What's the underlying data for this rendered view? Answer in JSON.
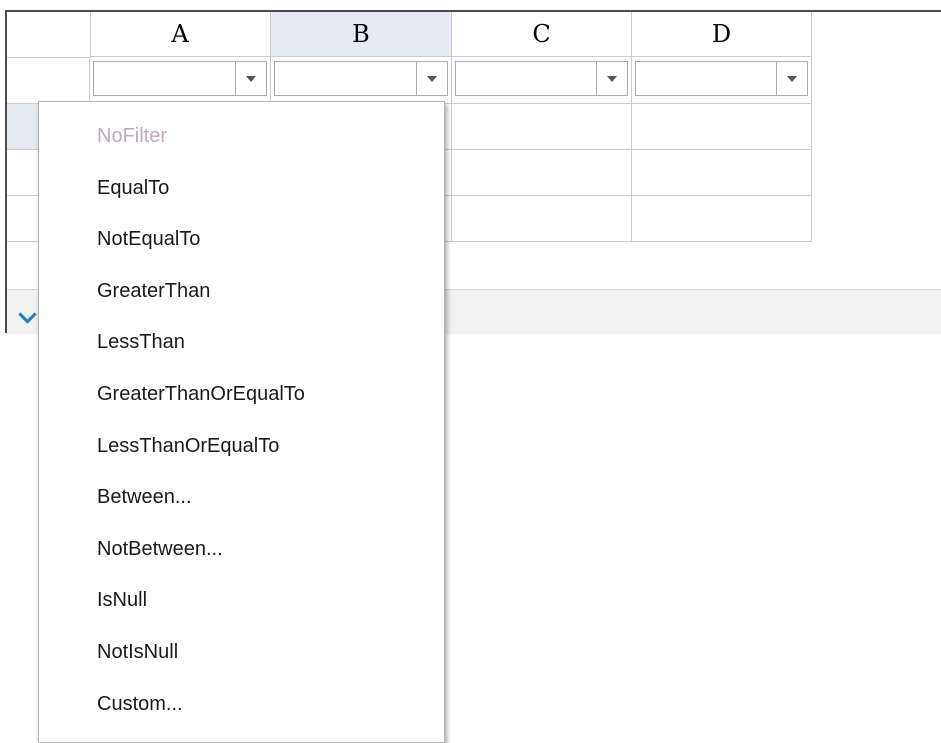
{
  "columns": [
    {
      "label": "A",
      "selected": false
    },
    {
      "label": "B",
      "selected": true
    },
    {
      "label": "C",
      "selected": false
    },
    {
      "label": "D",
      "selected": false
    }
  ],
  "filter_row": {
    "values": [
      "",
      "",
      "",
      ""
    ]
  },
  "filter_menu": {
    "items": [
      {
        "label": "NoFilter",
        "enabled": false
      },
      {
        "label": "EqualTo",
        "enabled": true
      },
      {
        "label": "NotEqualTo",
        "enabled": true
      },
      {
        "label": "GreaterThan",
        "enabled": true
      },
      {
        "label": "LessThan",
        "enabled": true
      },
      {
        "label": "GreaterThanOrEqualTo",
        "enabled": true
      },
      {
        "label": "LessThanOrEqualTo",
        "enabled": true
      },
      {
        "label": "Between...",
        "enabled": true
      },
      {
        "label": "NotBetween...",
        "enabled": true
      },
      {
        "label": "IsNull",
        "enabled": true
      },
      {
        "label": "NotIsNull",
        "enabled": true
      },
      {
        "label": "Custom...",
        "enabled": true
      }
    ]
  },
  "icons": {
    "dropdown": "chevron-down-icon",
    "footer_toggle": "chevron-down-icon"
  },
  "colors": {
    "selected_header": "#e6eaf4",
    "disabled_item": "#c4a6bf",
    "accent": "#1e7fc8"
  }
}
